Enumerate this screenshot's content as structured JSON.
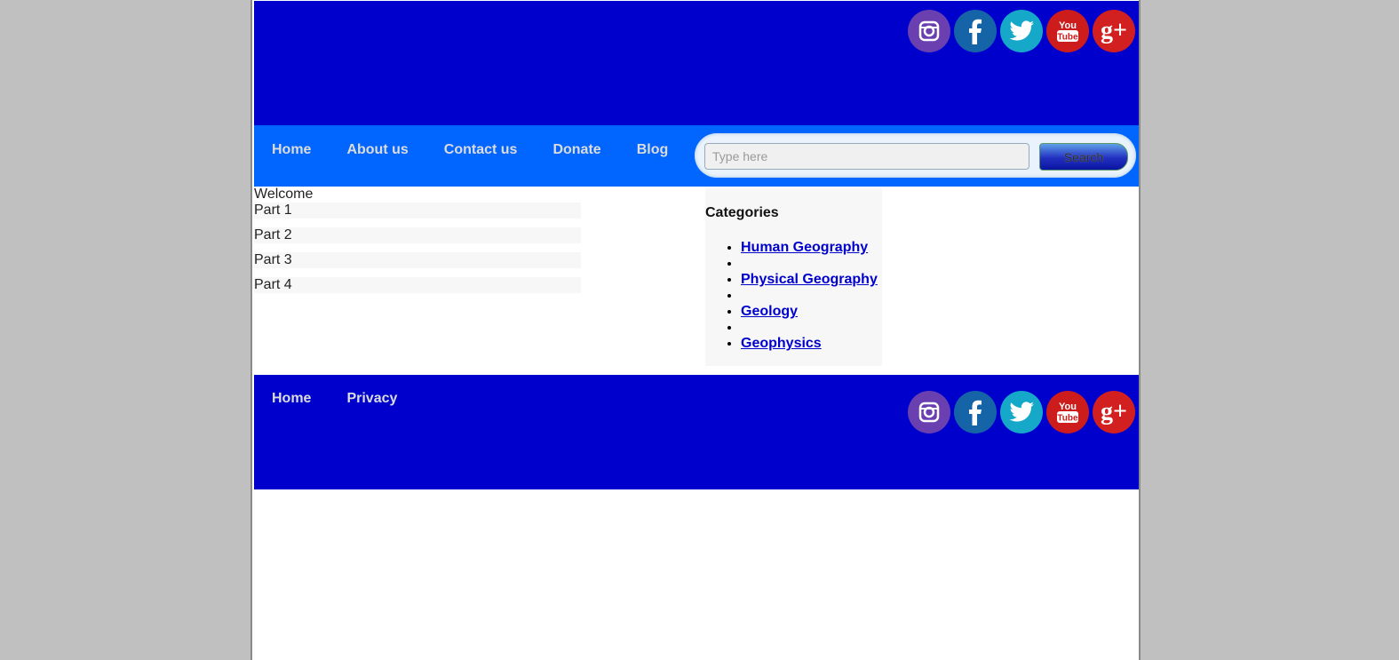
{
  "header": {
    "social": [
      {
        "icon": "instagram-icon",
        "color": "#6a3fb0"
      },
      {
        "icon": "facebook-icon",
        "color": "#1664a8"
      },
      {
        "icon": "twitter-icon",
        "color": "#16a8c8"
      },
      {
        "icon": "youtube-icon",
        "color": "#cc1c1c",
        "label_top": "You",
        "label_bottom": "Tube"
      },
      {
        "icon": "google-plus-icon",
        "color": "#d21f1f",
        "label": "g+"
      }
    ]
  },
  "nav": {
    "items": [
      "Home",
      "About us",
      "Contact us",
      "Donate",
      "Blog"
    ]
  },
  "search": {
    "placeholder": "Type here",
    "value": "",
    "button_label": "Search"
  },
  "main": {
    "welcome": "Welcome",
    "parts": [
      "Part 1",
      "Part 2",
      "Part 3",
      "Part 4"
    ]
  },
  "categories": {
    "title": "Categories",
    "items": [
      "Human Geography",
      "",
      "Physical Geography",
      "",
      "Geology",
      "",
      "Geophysics"
    ]
  },
  "footer": {
    "links": [
      "Home",
      "Privacy"
    ]
  },
  "colors": {
    "header_bg": "#0000cd",
    "nav_bg": "#0066ff",
    "page_bg": "#c0c0c0",
    "link": "#0000cc"
  }
}
